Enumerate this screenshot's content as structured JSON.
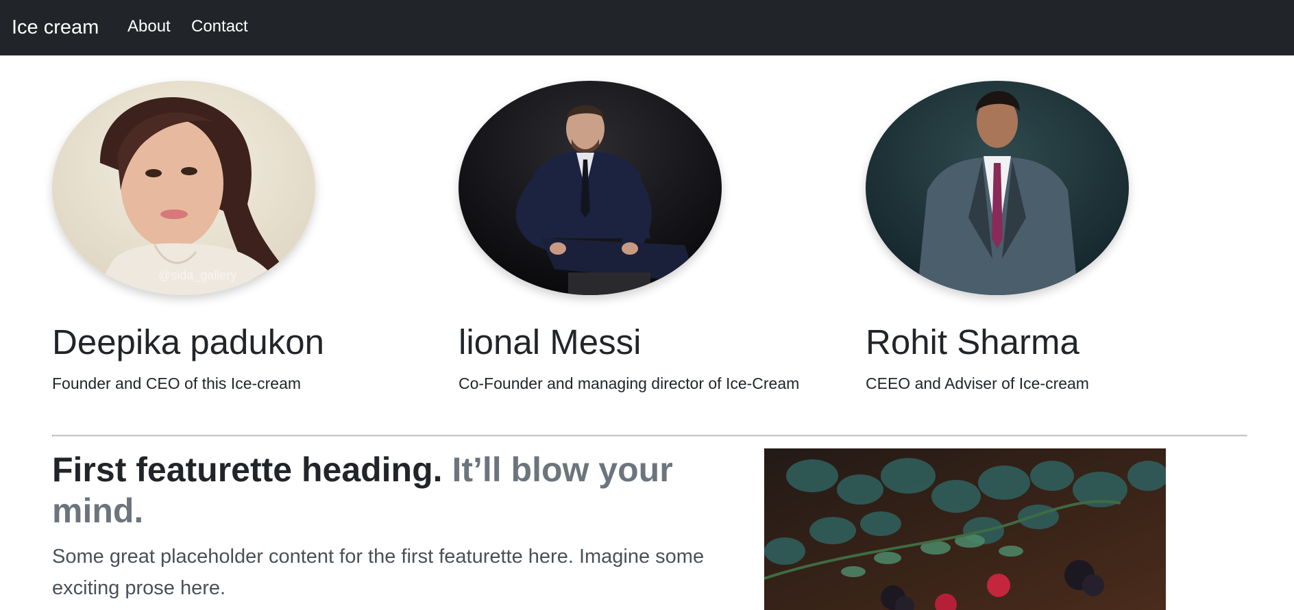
{
  "navbar": {
    "brand": "Ice cream",
    "links": [
      {
        "label": "About"
      },
      {
        "label": "Contact"
      }
    ]
  },
  "team": [
    {
      "name": "Deepika padukon",
      "role": "Founder and CEO of this Ice-cream",
      "photo_watermark": "@sida_gallery"
    },
    {
      "name": "lional Messi",
      "role": "Co-Founder and managing director of Ice-Cream"
    },
    {
      "name": "Rohit Sharma",
      "role": "CEEO and Adviser of Ice-cream"
    }
  ],
  "featurette": {
    "heading": "First featurette heading.",
    "heading_muted": "It’ll blow your mind.",
    "text": "Some great placeholder content for the first featurette here. Imagine some exciting prose here.",
    "image_subject": "berries-and-leaves-photo"
  },
  "colors": {
    "navbar_bg": "#212529",
    "text_primary": "#212529",
    "text_muted": "#6c757d",
    "divider": "#c4c6c8"
  }
}
